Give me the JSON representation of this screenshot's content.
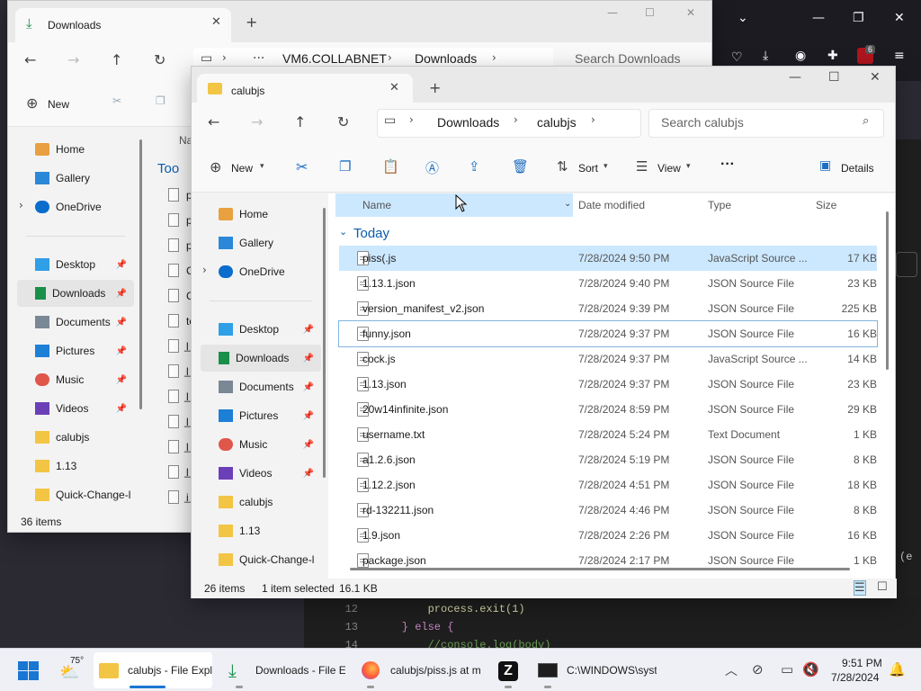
{
  "browser": {
    "tab_down_icon": "chevron-down",
    "minimize": "—",
    "restore": "❐",
    "close": "✕",
    "ext_badge": "6"
  },
  "code": {
    "lines": [
      {
        "n": "12",
        "t": "        process.exit(1)"
      },
      {
        "n": "13",
        "t": "    } else {"
      },
      {
        "n": "14",
        "t": "        //console.log(body)"
      }
    ],
    "edge_text": "(e"
  },
  "back_window": {
    "tab_title": "Downloads",
    "new_tab": "+",
    "breadcrumb": [
      "VM6.COLLABNET",
      "Downloads"
    ],
    "ellipsis": "···",
    "search_placeholder": "Search Downloads",
    "new_label": "New",
    "column_partial": "Na",
    "group_partial": "Too",
    "nav": [
      {
        "label": "Home",
        "icon": "home-icon"
      },
      {
        "label": "Gallery",
        "icon": "gallery-icon"
      },
      {
        "label": "OneDrive",
        "icon": "onedrive-icon"
      },
      {
        "label": "Desktop",
        "icon": "desktop-icon"
      },
      {
        "label": "Downloads",
        "icon": "download-icon"
      },
      {
        "label": "Documents",
        "icon": "documents-icon"
      },
      {
        "label": "Pictures",
        "icon": "pictures-icon"
      },
      {
        "label": "Music",
        "icon": "music-icon"
      },
      {
        "label": "Videos",
        "icon": "videos-icon"
      },
      {
        "label": "calubjs",
        "icon": "folder-icon"
      },
      {
        "label": "1.13",
        "icon": "folder-icon"
      },
      {
        "label": "Quick-Change-l",
        "icon": "folder-icon"
      }
    ],
    "partial_rows": [
      "p",
      "p",
      "p",
      "C",
      "C",
      "te",
      "l̲",
      "l̲",
      "l̲",
      "l̲",
      "l̲",
      "l̲",
      "i̲"
    ],
    "status": "36 items"
  },
  "front_window": {
    "tab_title": "calubjs",
    "new_tab": "+",
    "breadcrumb": [
      "Downloads",
      "calubjs"
    ],
    "search_placeholder": "Search calubjs",
    "toolbar": {
      "new": "New",
      "sort": "Sort",
      "view": "View",
      "more": "···",
      "details": "Details"
    },
    "nav": [
      {
        "label": "Home",
        "icon": "home-icon"
      },
      {
        "label": "Gallery",
        "icon": "gallery-icon"
      },
      {
        "label": "OneDrive",
        "icon": "onedrive-icon"
      },
      {
        "label": "Desktop",
        "icon": "desktop-icon"
      },
      {
        "label": "Downloads",
        "icon": "download-icon"
      },
      {
        "label": "Documents",
        "icon": "documents-icon"
      },
      {
        "label": "Pictures",
        "icon": "pictures-icon"
      },
      {
        "label": "Music",
        "icon": "music-icon"
      },
      {
        "label": "Videos",
        "icon": "videos-icon"
      },
      {
        "label": "calubjs",
        "icon": "folder-icon"
      },
      {
        "label": "1.13",
        "icon": "folder-icon"
      },
      {
        "label": "Quick-Change-l",
        "icon": "folder-icon"
      }
    ],
    "columns": [
      "Name",
      "Date modified",
      "Type",
      "Size"
    ],
    "group": "Today",
    "files": [
      {
        "name": "piss(.js",
        "date": "7/28/2024 9:50 PM",
        "type": "JavaScript Source ...",
        "size": "17 KB",
        "selected": true
      },
      {
        "name": "1.13.1.json",
        "date": "7/28/2024 9:40 PM",
        "type": "JSON Source File",
        "size": "23 KB"
      },
      {
        "name": "version_manifest_v2.json",
        "date": "7/28/2024 9:39 PM",
        "type": "JSON Source File",
        "size": "225 KB"
      },
      {
        "name": "funny.json",
        "date": "7/28/2024 9:37 PM",
        "type": "JSON Source File",
        "size": "16 KB",
        "focused": true
      },
      {
        "name": "cock.js",
        "date": "7/28/2024 9:37 PM",
        "type": "JavaScript Source ...",
        "size": "14 KB"
      },
      {
        "name": "1.13.json",
        "date": "7/28/2024 9:37 PM",
        "type": "JSON Source File",
        "size": "23 KB"
      },
      {
        "name": "20w14infinite.json",
        "date": "7/28/2024 8:59 PM",
        "type": "JSON Source File",
        "size": "29 KB"
      },
      {
        "name": "username.txt",
        "date": "7/28/2024 5:24 PM",
        "type": "Text Document",
        "size": "1 KB"
      },
      {
        "name": "a1.2.6.json",
        "date": "7/28/2024 5:19 PM",
        "type": "JSON Source File",
        "size": "8 KB"
      },
      {
        "name": "1.12.2.json",
        "date": "7/28/2024 4:51 PM",
        "type": "JSON Source File",
        "size": "18 KB"
      },
      {
        "name": "rd-132211.json",
        "date": "7/28/2024 4:46 PM",
        "type": "JSON Source File",
        "size": "8 KB"
      },
      {
        "name": "1.9.json",
        "date": "7/28/2024 2:26 PM",
        "type": "JSON Source File",
        "size": "16 KB"
      },
      {
        "name": "package.json",
        "date": "7/28/2024 2:17 PM",
        "type": "JSON Source File",
        "size": "1 KB"
      }
    ],
    "status": {
      "count": "26 items",
      "selected": "1 item selected",
      "size": "16.1 KB"
    }
  },
  "taskbar": {
    "weather_temp": "75°",
    "apps": [
      {
        "label": "calubjs - File Expl",
        "icon": "folder-icon",
        "active": true
      },
      {
        "label": "Downloads - File E",
        "icon": "download-icon"
      },
      {
        "label": "calubjs/piss.js at m",
        "icon": "firefox-icon"
      },
      {
        "label": "",
        "icon": "z-app-icon"
      },
      {
        "label": "C:\\WINDOWS\\syst",
        "icon": "terminal-icon"
      }
    ],
    "time": "9:51 PM",
    "date": "7/28/2024"
  }
}
